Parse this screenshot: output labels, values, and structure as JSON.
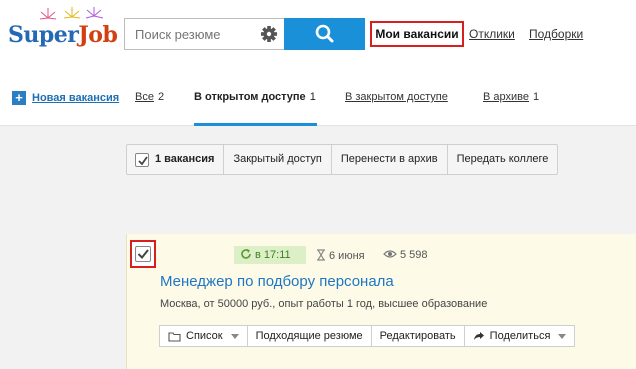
{
  "header": {
    "logo_main": "Super",
    "logo_accent": "Job",
    "search_placeholder": "Поиск резюме",
    "nav_my_vacancies": "Мои вакансии",
    "nav_responses": "Отклики",
    "nav_collections": "Подборки"
  },
  "subnav": {
    "new_vacancy": "Новая вакансия",
    "tabs": [
      {
        "label": "Все",
        "count": "2"
      },
      {
        "label": "В открытом доступе",
        "count": "1"
      },
      {
        "label": "В закрытом доступе",
        "count": ""
      },
      {
        "label": "В архиве",
        "count": "1"
      }
    ]
  },
  "action_bar": {
    "selected": "1 вакансия",
    "closed_access": "Закрытый доступ",
    "move_archive": "Перенести в архив",
    "transfer": "Передать коллеге"
  },
  "vacancy": {
    "updated": "в 17:11",
    "date": "6 июня",
    "views": "5 598",
    "title": "Менеджер по подбору персонала",
    "description": "Москва, от 50000 руб., опыт работы 1 год, высшее образование",
    "actions": {
      "list": "Список",
      "matching": "Подходящие резюме",
      "edit": "Редактировать",
      "share": "Поделиться"
    }
  },
  "colors": {
    "brand_blue": "#1a90d8",
    "highlight_red": "#d62020",
    "card_bg": "#fdfbe8",
    "badge_green": "#dcefc6"
  }
}
